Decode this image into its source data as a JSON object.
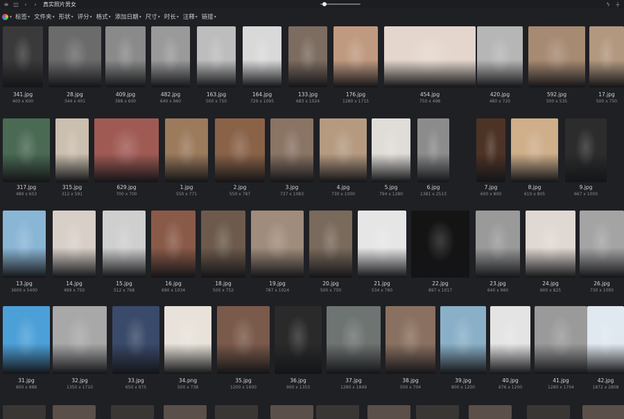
{
  "window": {
    "title": "真实照片男女",
    "zoom_percent": 5
  },
  "toolbar": {
    "filters": [
      {
        "label": "标签"
      },
      {
        "label": "文件夹"
      },
      {
        "label": "形状"
      },
      {
        "label": "评分"
      },
      {
        "label": "格式"
      },
      {
        "label": "添加日期"
      },
      {
        "label": "尺寸"
      },
      {
        "label": "时长"
      },
      {
        "label": "注释"
      },
      {
        "label": "链接"
      }
    ]
  },
  "rows": [
    {
      "items": [
        {
          "name": "341.jpg",
          "dims": "400 x 600",
          "tone": "#3a3a3a"
        },
        {
          "name": "28.jpg",
          "dims": "344 x 401",
          "tone": "#6b6b6b"
        },
        {
          "name": "409.jpg",
          "dims": "398 x 600",
          "tone": "#8a8a8a"
        },
        {
          "name": "482.jpg",
          "dims": "640 x 960",
          "tone": "#9a9a9a"
        },
        {
          "name": "163.jpg",
          "dims": "500 x 750",
          "tone": "#bdbdbd"
        },
        {
          "name": "164.jpg",
          "dims": "729 x 1095",
          "tone": "#d9d9d9"
        },
        {
          "name": "133.jpg",
          "dims": "683 x 1024",
          "tone": "#7d6c60"
        },
        {
          "name": "176.jpg",
          "dims": "1280 x 1715",
          "tone": "#c09a80"
        },
        {
          "name": "454.jpg",
          "dims": "750 x 498",
          "tone": "#e4d6cc"
        },
        {
          "name": "420.jpg",
          "dims": "480 x 720",
          "tone": "#b6b6b6"
        },
        {
          "name": "592.jpg",
          "dims": "500 x 535",
          "tone": "#a78a72"
        },
        {
          "name": "17.jpg",
          "dims": "500 x 750",
          "tone": "#b39880"
        }
      ]
    },
    {
      "items": [
        {
          "name": "317.jpg",
          "dims": "489 x 653",
          "tone": "#4a6a54"
        },
        {
          "name": "315.jpg",
          "dims": "312 x 591",
          "tone": "#cbbfaf"
        },
        {
          "name": "629.jpg",
          "dims": "700 x 700",
          "tone": "#a05a54"
        },
        {
          "name": "1.jpg",
          "dims": "550 x 771",
          "tone": "#9c7a5c"
        },
        {
          "name": "2.jpg",
          "dims": "550 x 787",
          "tone": "#8a6248"
        },
        {
          "name": "3.jpg",
          "dims": "737 x 1083",
          "tone": "#8a7464"
        },
        {
          "name": "4.jpg",
          "dims": "730 x 1000",
          "tone": "#b59a80"
        },
        {
          "name": "5.jpg",
          "dims": "794 x 1280",
          "tone": "#e0dcd8"
        },
        {
          "name": "6.jpg",
          "dims": "1381 x 2513",
          "tone": "#8c8c8c"
        },
        {
          "name": "7.jpg",
          "dims": "600 x 800",
          "tone": "#4d3326"
        },
        {
          "name": "8.jpg",
          "dims": "610 x 805",
          "tone": "#cfae8a"
        },
        {
          "name": "9.jpg",
          "dims": "667 x 1000",
          "tone": "#2c2c2c"
        }
      ]
    },
    {
      "items": [
        {
          "name": "13.jpg",
          "dims": "3600 x 5400",
          "tone": "#8ab6d6"
        },
        {
          "name": "14.jpg",
          "dims": "499 x 750",
          "tone": "#d8cfc8"
        },
        {
          "name": "15.jpg",
          "dims": "512 x 768",
          "tone": "#cfcfcf"
        },
        {
          "name": "16.jpg",
          "dims": "690 x 1034",
          "tone": "#8a5a48"
        },
        {
          "name": "18.jpg",
          "dims": "500 x 752",
          "tone": "#6d5a4c"
        },
        {
          "name": "19.jpg",
          "dims": "787 x 1024",
          "tone": "#a08c7c"
        },
        {
          "name": "20.jpg",
          "dims": "500 x 750",
          "tone": "#7a6a5c"
        },
        {
          "name": "21.jpg",
          "dims": "534 x 760",
          "tone": "#e6e6e6"
        },
        {
          "name": "22.jpg",
          "dims": "897 x 1017",
          "tone": "#141414"
        },
        {
          "name": "23.jpg",
          "dims": "640 x 960",
          "tone": "#9a9a9a"
        },
        {
          "name": "24.jpg",
          "dims": "600 x 825",
          "tone": "#e0d8d2"
        },
        {
          "name": "26.jpg",
          "dims": "730 x 1095",
          "tone": "#a4a4a4"
        }
      ]
    },
    {
      "items": [
        {
          "name": "31.jpg",
          "dims": "600 x 888",
          "tone": "#4ca0d8"
        },
        {
          "name": "32.jpg",
          "dims": "1350 x 1710",
          "tone": "#a8a8a8"
        },
        {
          "name": "33.jpg",
          "dims": "650 x 975",
          "tone": "#3a4a6a"
        },
        {
          "name": "34.png",
          "dims": "500 x 738",
          "tone": "#e8e2da"
        },
        {
          "name": "35.jpg",
          "dims": "1200 x 1600",
          "tone": "#7a5a4a"
        },
        {
          "name": "36.jpg",
          "dims": "900 x 1353",
          "tone": "#2a2a2a"
        },
        {
          "name": "37.jpg",
          "dims": "1280 x 1849",
          "tone": "#6e7472"
        },
        {
          "name": "38.jpg",
          "dims": "500 x 704",
          "tone": "#8a7060"
        },
        {
          "name": "39.jpg",
          "dims": "800 x 1200",
          "tone": "#8ab0c8"
        },
        {
          "name": "40.jpg",
          "dims": "676 x 1200",
          "tone": "#e4e4e4"
        },
        {
          "name": "41.jpg",
          "dims": "1280 x 1704",
          "tone": "#9a9a9a"
        },
        {
          "name": "42.jpg",
          "dims": "1872 x 2808",
          "tone": "#e0e8f0"
        }
      ]
    }
  ]
}
